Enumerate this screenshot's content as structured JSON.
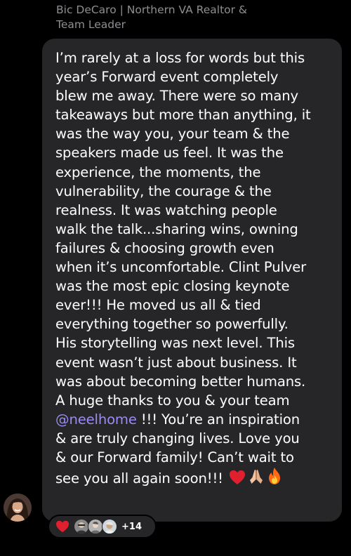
{
  "sender": {
    "line1": "Bic DeCaro | Northern VA Realtor &",
    "line2": "Team Leader"
  },
  "message": {
    "lines": [
      "I’m rarely at a loss for words but this",
      "year’s Forward event completely",
      "blew me away. There were so many",
      "takeaways but more than anything, it",
      "was the way you, your team & the",
      "speakers made us feel. It was the",
      "experience, the moments, the",
      "vulnerability, the courage & the",
      "realness. It was watching people",
      "walk the talk...sharing wins, owning",
      "failures & choosing growth even",
      "when it’s uncomfortable. Clint Pulver",
      "was the most epic closing keynote",
      "ever!!! He moved us all & tied",
      "everything together so powerfully.",
      "His storytelling was next level. This",
      "event wasn’t just about business. It",
      "was about becoming better humans.",
      "A huge thanks to you & your team"
    ],
    "mention": "@neelhome",
    "after_mention": " !!! You’re an inspiration",
    "line_after1": "& are truly changing lives. Love you",
    "line_after2": "& our Forward family! Can’t wait to",
    "last_line": "see you all again soon!!! ",
    "emojis": [
      "red-heart",
      "folded-hands",
      "fire"
    ]
  },
  "reactions": {
    "count": "+14",
    "emoji": "red-heart"
  },
  "colors": {
    "background": "#000000",
    "bubble": "#262628",
    "sender_text": "#8e8e93",
    "mention": "#9a8cf3",
    "heart": "#e0202e"
  }
}
